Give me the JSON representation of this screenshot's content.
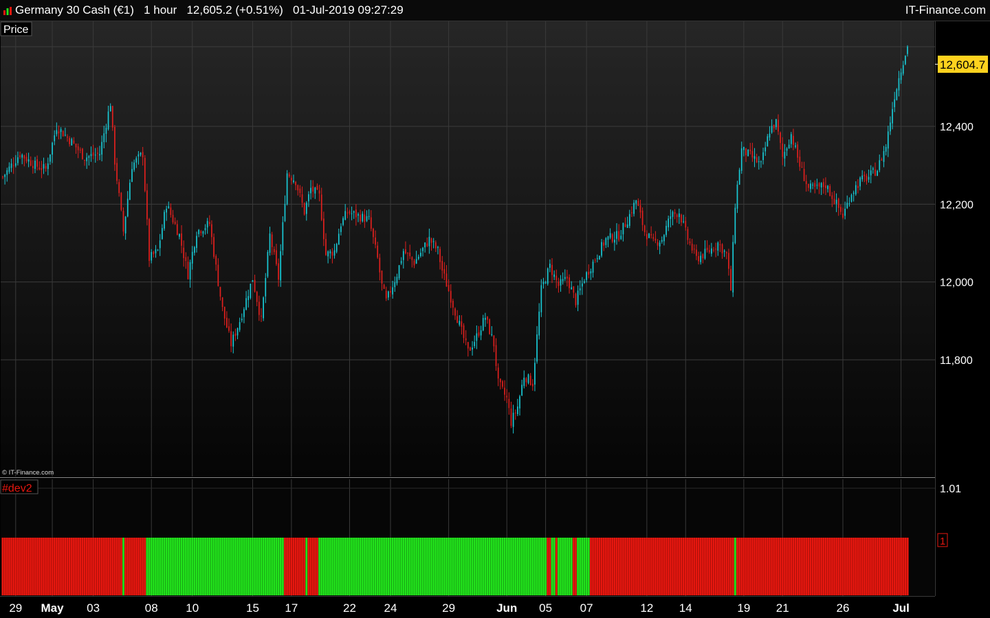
{
  "header": {
    "instrument": "Germany 30 Cash (€1)",
    "timeframe": "1 hour",
    "last_quote": "12,605.2 (+0.51%)",
    "datetime": "01-Jul-2019 09:27:29",
    "brand": "IT-Finance.com"
  },
  "price_panel": {
    "label": "Price",
    "copyright": "© IT-Finance.com",
    "last_price_label": "12,604.7"
  },
  "indicator_panel": {
    "label": "#dev2",
    "scale_top_label": "1.01",
    "value_label": "1"
  },
  "colors": {
    "up_candle": "#19c8d4",
    "down_candle": "#e0201e",
    "bull_bar": "#22e41c",
    "bear_bar": "#e8170f",
    "price_tag": "#ffd21e"
  },
  "chart_data": [
    {
      "type": "candlestick",
      "title": "Germany 30 Cash (€1)",
      "timeframe": "1 hour",
      "ylim": [
        11500,
        12670
      ],
      "y_ticks": [
        {
          "value": 11800,
          "label": "11,800"
        },
        {
          "value": 12000,
          "label": "12,000"
        },
        {
          "value": 12200,
          "label": "12,200"
        },
        {
          "value": 12400,
          "label": "12,400"
        }
      ],
      "x_labels": [
        {
          "label": "29",
          "bold": false,
          "bar": 6
        },
        {
          "label": "May",
          "bold": true,
          "bar": 23
        },
        {
          "label": "03",
          "bold": false,
          "bar": 42
        },
        {
          "label": "08",
          "bold": false,
          "bar": 69
        },
        {
          "label": "10",
          "bold": false,
          "bar": 88
        },
        {
          "label": "15",
          "bold": false,
          "bar": 116
        },
        {
          "label": "17",
          "bold": false,
          "bar": 134
        },
        {
          "label": "22",
          "bold": false,
          "bar": 161
        },
        {
          "label": "24",
          "bold": false,
          "bar": 180
        },
        {
          "label": "29",
          "bold": false,
          "bar": 207
        },
        {
          "label": "Jun",
          "bold": true,
          "bar": 234
        },
        {
          "label": "05",
          "bold": false,
          "bar": 252
        },
        {
          "label": "07",
          "bold": false,
          "bar": 271
        },
        {
          "label": "12",
          "bold": false,
          "bar": 299
        },
        {
          "label": "14",
          "bold": false,
          "bar": 317
        },
        {
          "label": "19",
          "bold": false,
          "bar": 344
        },
        {
          "label": "21",
          "bold": false,
          "bar": 362
        },
        {
          "label": "26",
          "bold": false,
          "bar": 390
        },
        {
          "label": "Jul",
          "bold": true,
          "bar": 417
        }
      ],
      "last_price": 12604.7,
      "anchors": [
        [
          0,
          12270
        ],
        [
          8,
          12330
        ],
        [
          15,
          12300
        ],
        [
          20,
          12290
        ],
        [
          25,
          12400
        ],
        [
          32,
          12360
        ],
        [
          38,
          12320
        ],
        [
          45,
          12330
        ],
        [
          50,
          12460
        ],
        [
          52,
          12310
        ],
        [
          56,
          12130
        ],
        [
          60,
          12300
        ],
        [
          65,
          12330
        ],
        [
          68,
          12060
        ],
        [
          72,
          12080
        ],
        [
          76,
          12200
        ],
        [
          82,
          12120
        ],
        [
          86,
          12020
        ],
        [
          90,
          12130
        ],
        [
          96,
          12150
        ],
        [
          100,
          12000
        ],
        [
          102,
          11930
        ],
        [
          106,
          11840
        ],
        [
          110,
          11900
        ],
        [
          116,
          12010
        ],
        [
          120,
          11900
        ],
        [
          124,
          12120
        ],
        [
          128,
          12010
        ],
        [
          132,
          12280
        ],
        [
          136,
          12260
        ],
        [
          140,
          12180
        ],
        [
          143,
          12240
        ],
        [
          147,
          12220
        ],
        [
          150,
          12070
        ],
        [
          154,
          12080
        ],
        [
          157,
          12150
        ],
        [
          160,
          12180
        ],
        [
          165,
          12170
        ],
        [
          170,
          12160
        ],
        [
          174,
          12060
        ],
        [
          176,
          11990
        ],
        [
          178,
          11950
        ],
        [
          183,
          12020
        ],
        [
          186,
          12080
        ],
        [
          191,
          12050
        ],
        [
          198,
          12110
        ],
        [
          202,
          12080
        ],
        [
          204,
          12030
        ],
        [
          208,
          11960
        ],
        [
          212,
          11890
        ],
        [
          216,
          11820
        ],
        [
          220,
          11860
        ],
        [
          224,
          11910
        ],
        [
          228,
          11840
        ],
        [
          230,
          11740
        ],
        [
          234,
          11700
        ],
        [
          236,
          11640
        ],
        [
          239,
          11680
        ],
        [
          242,
          11760
        ],
        [
          246,
          11740
        ],
        [
          250,
          11980
        ],
        [
          254,
          12040
        ],
        [
          258,
          11990
        ],
        [
          262,
          12010
        ],
        [
          266,
          11950
        ],
        [
          270,
          12010
        ],
        [
          276,
          12070
        ],
        [
          280,
          12110
        ],
        [
          286,
          12120
        ],
        [
          290,
          12160
        ],
        [
          294,
          12210
        ],
        [
          298,
          12130
        ],
        [
          302,
          12100
        ],
        [
          306,
          12110
        ],
        [
          310,
          12170
        ],
        [
          314,
          12180
        ],
        [
          318,
          12110
        ],
        [
          322,
          12060
        ],
        [
          328,
          12080
        ],
        [
          332,
          12100
        ],
        [
          336,
          12070
        ],
        [
          338,
          11980
        ],
        [
          340,
          12200
        ],
        [
          343,
          12340
        ],
        [
          348,
          12320
        ],
        [
          352,
          12300
        ],
        [
          356,
          12390
        ],
        [
          359,
          12410
        ],
        [
          362,
          12320
        ],
        [
          366,
          12380
        ],
        [
          370,
          12300
        ],
        [
          374,
          12240
        ],
        [
          378,
          12240
        ],
        [
          382,
          12250
        ],
        [
          386,
          12210
        ],
        [
          390,
          12170
        ],
        [
          394,
          12230
        ],
        [
          398,
          12260
        ],
        [
          402,
          12270
        ],
        [
          406,
          12290
        ],
        [
          410,
          12350
        ],
        [
          414,
          12480
        ],
        [
          418,
          12570
        ],
        [
          420,
          12605
        ]
      ]
    },
    {
      "type": "bar",
      "title": "#dev2",
      "ylim": [
        0,
        1.01
      ],
      "y_ticks": [
        {
          "value": 1.01,
          "label": "1.01"
        }
      ],
      "value": 1,
      "segments": [
        {
          "start": 0,
          "end": 55,
          "signal": "bear"
        },
        {
          "start": 56,
          "end": 56,
          "signal": "bull"
        },
        {
          "start": 57,
          "end": 66,
          "signal": "bear"
        },
        {
          "start": 67,
          "end": 130,
          "signal": "bull"
        },
        {
          "start": 131,
          "end": 140,
          "signal": "bear"
        },
        {
          "start": 141,
          "end": 141,
          "signal": "bull"
        },
        {
          "start": 142,
          "end": 146,
          "signal": "bear"
        },
        {
          "start": 147,
          "end": 252,
          "signal": "bull"
        },
        {
          "start": 253,
          "end": 254,
          "signal": "bear"
        },
        {
          "start": 255,
          "end": 256,
          "signal": "bull"
        },
        {
          "start": 257,
          "end": 257,
          "signal": "bear"
        },
        {
          "start": 258,
          "end": 264,
          "signal": "bull"
        },
        {
          "start": 265,
          "end": 266,
          "signal": "bear"
        },
        {
          "start": 267,
          "end": 272,
          "signal": "bull"
        },
        {
          "start": 273,
          "end": 339,
          "signal": "bear"
        },
        {
          "start": 340,
          "end": 340,
          "signal": "bull"
        },
        {
          "start": 341,
          "end": 420,
          "signal": "bear"
        }
      ]
    }
  ]
}
